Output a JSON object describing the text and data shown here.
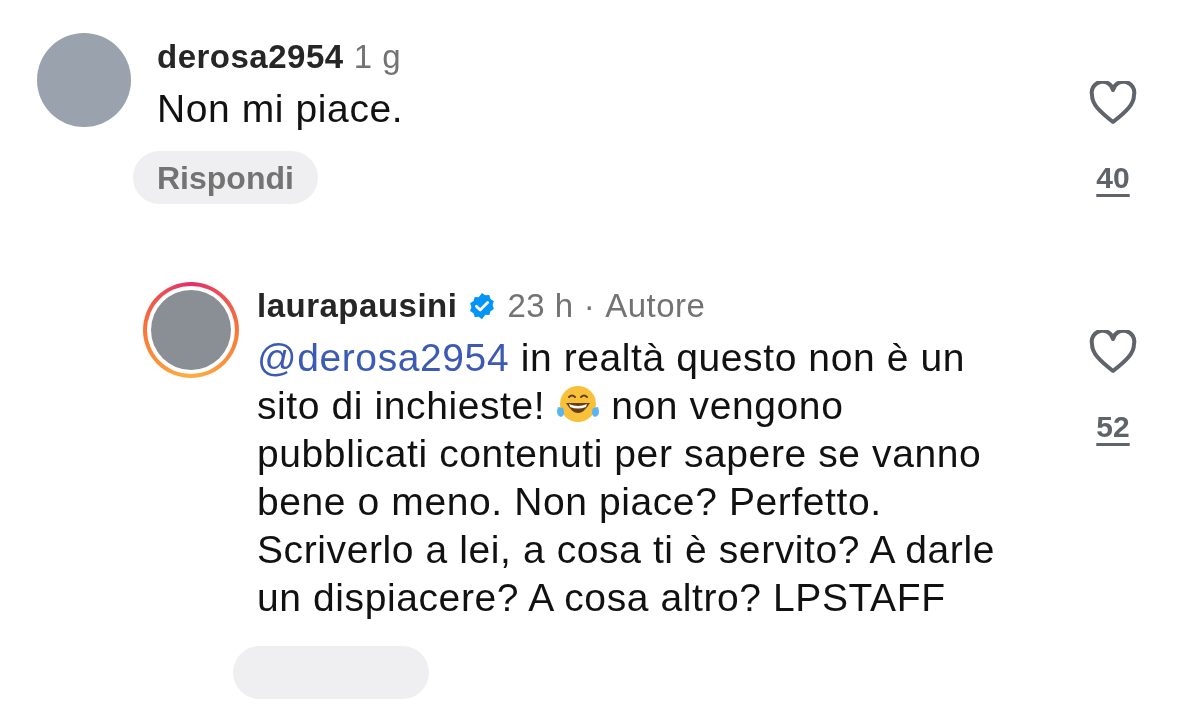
{
  "comments": [
    {
      "username": "derosa2954",
      "verified": false,
      "time": "1 g",
      "story_ring": false,
      "text": "Non mi piace.",
      "reply_label": "Rispondi",
      "likes": "40",
      "liked": false
    },
    {
      "username": "laurapausini",
      "verified": true,
      "time": "23 h",
      "separator": "·",
      "author_label": "Autore",
      "story_ring": true,
      "mention": "@derosa2954",
      "text": "in realtà questo non è un sito di inchieste!",
      "text_after_emoji": "non vengono pubblicati contenuti per sapere se vanno bene o meno. Non piace? Perfetto. Scriverlo a lei, a cosa ti è servito? A darle un dispiacere? A cosa altro? LPSTAFF",
      "likes": "52",
      "liked": false
    }
  ]
}
